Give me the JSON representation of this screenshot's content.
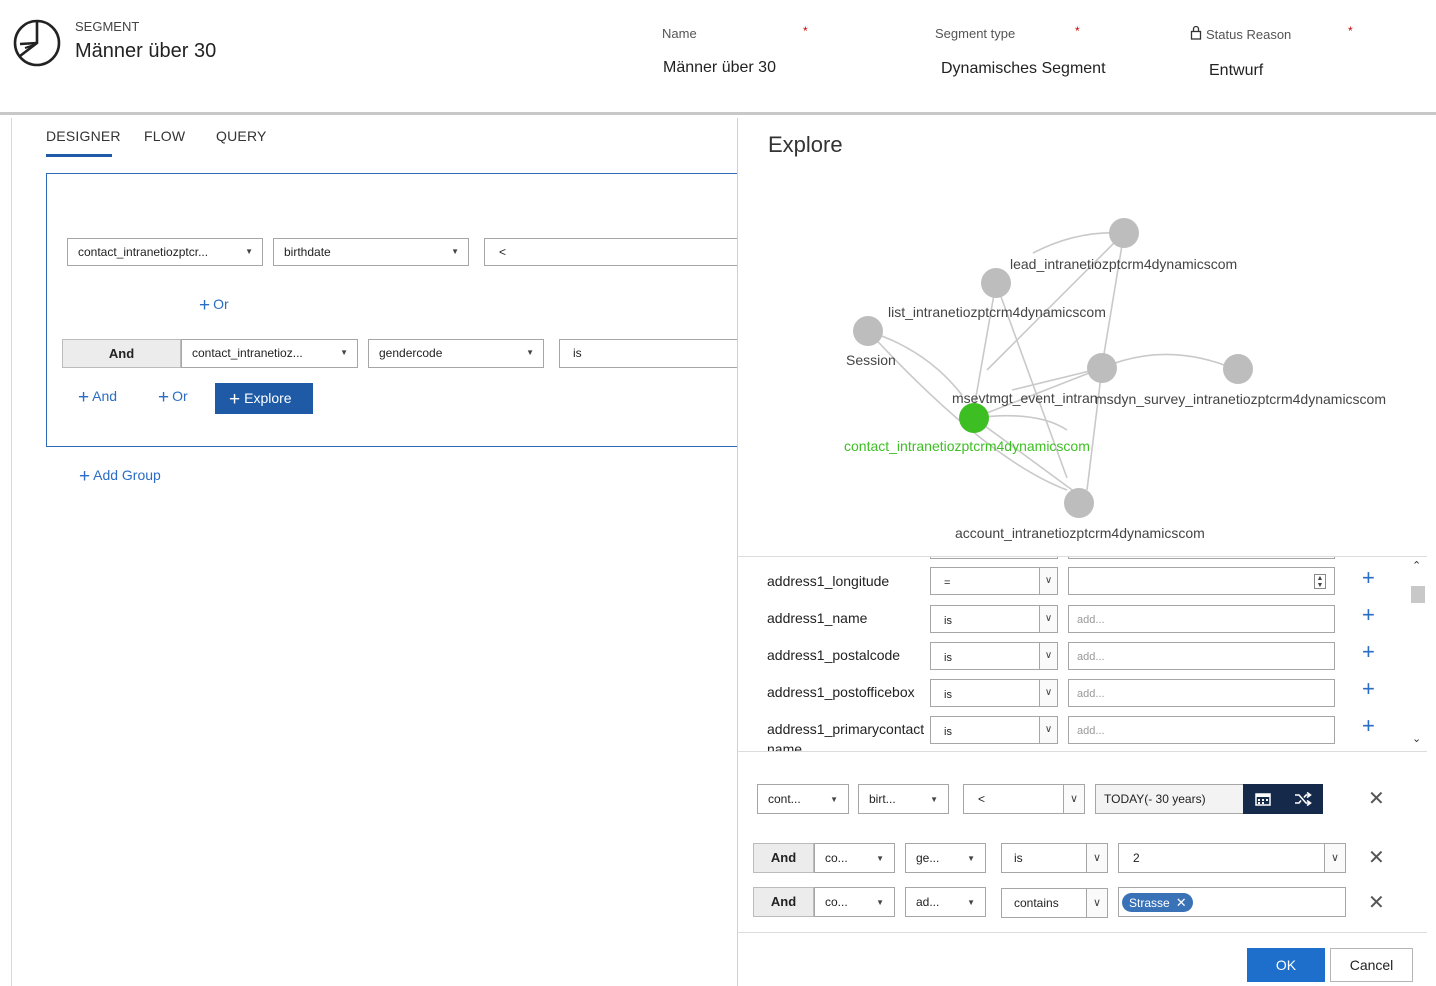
{
  "header": {
    "entity_label": "SEGMENT",
    "title": "Männer über 30",
    "fields": [
      {
        "label": "Name",
        "value": "Männer über 30",
        "required_mark": "*"
      },
      {
        "label": "Segment type",
        "value": "Dynamisches Segment",
        "required_mark": "*"
      },
      {
        "label": "Status Reason",
        "value": "Entwurf",
        "required_mark": "*",
        "locked_icon": "lock-icon"
      }
    ]
  },
  "tabs": [
    {
      "label": "DESIGNER",
      "active": true
    },
    {
      "label": "FLOW",
      "active": false
    },
    {
      "label": "QUERY",
      "active": false
    }
  ],
  "designer": {
    "row1": {
      "entity": "contact_intranetiozptcr...",
      "attribute": "birthdate",
      "operator": "<"
    },
    "or_label": "Or",
    "row2": {
      "connector": "And",
      "entity": "contact_intranetioz...",
      "attribute": "gendercode",
      "operator": "is"
    },
    "and_link": "And",
    "or_link": "Or",
    "explore_button": "Explore",
    "add_group": "Add Group"
  },
  "explore": {
    "title": "Explore",
    "graph": {
      "nodes": [
        {
          "id": "lead",
          "label": "lead_intranetiozptcrm4dynamicscom"
        },
        {
          "id": "list",
          "label": "list_intranetiozptcrm4dynamicscom"
        },
        {
          "id": "session",
          "label": "Session"
        },
        {
          "id": "msevtmgt",
          "label": "msevtmgt_event_intran"
        },
        {
          "id": "survey",
          "label": "msdyn_survey_intranetiozptcrm4dynamicscom"
        },
        {
          "id": "extra",
          "label": ""
        },
        {
          "id": "contact",
          "label": "contact_intranetiozptcrm4dynamicscom",
          "selected": true
        },
        {
          "id": "account",
          "label": "account_intranetiozptcrm4dynamicscom"
        }
      ],
      "colors": {
        "node": "#bdbdbd",
        "selected": "#3dbf23",
        "edge": "#c9c9c9"
      }
    },
    "attributes": [
      {
        "name": "address1_longitude",
        "operator": "=",
        "value": "",
        "type": "number"
      },
      {
        "name": "address1_name",
        "operator": "is",
        "value": "add..."
      },
      {
        "name": "address1_postalcode",
        "operator": "is",
        "value": "add..."
      },
      {
        "name": "address1_postofficebox",
        "operator": "is",
        "value": "add..."
      },
      {
        "name": "address1_primarycontact",
        "name2": "name",
        "operator": "is",
        "value": "add..."
      }
    ],
    "conditions": [
      {
        "entity": "cont...",
        "attribute": "birt...",
        "operator": "<",
        "value": "TODAY(- 30 years)"
      },
      {
        "connector": "And",
        "entity": "co...",
        "attribute": "ge...",
        "operator": "is",
        "value": "2"
      },
      {
        "connector": "And",
        "entity": "co...",
        "attribute": "ad...",
        "operator": "contains",
        "chip": "Strasse"
      }
    ],
    "ok_label": "OK",
    "cancel_label": "Cancel"
  }
}
